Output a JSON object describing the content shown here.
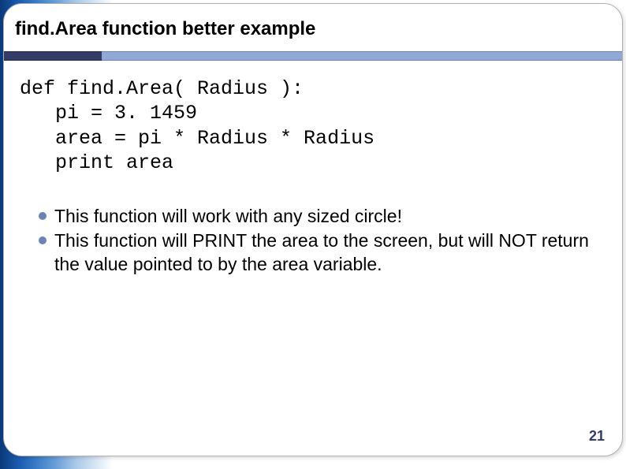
{
  "title": "find.Area function better example",
  "code": "def find.Area( Radius ):\n   pi = 3. 1459\n   area = pi * Radius * Radius\n   print area",
  "bullets": [
    "This function will work with any sized circle!",
    "This function will PRINT the area to the screen, but will NOT return the value pointed to by the area variable."
  ],
  "page_number": "21"
}
